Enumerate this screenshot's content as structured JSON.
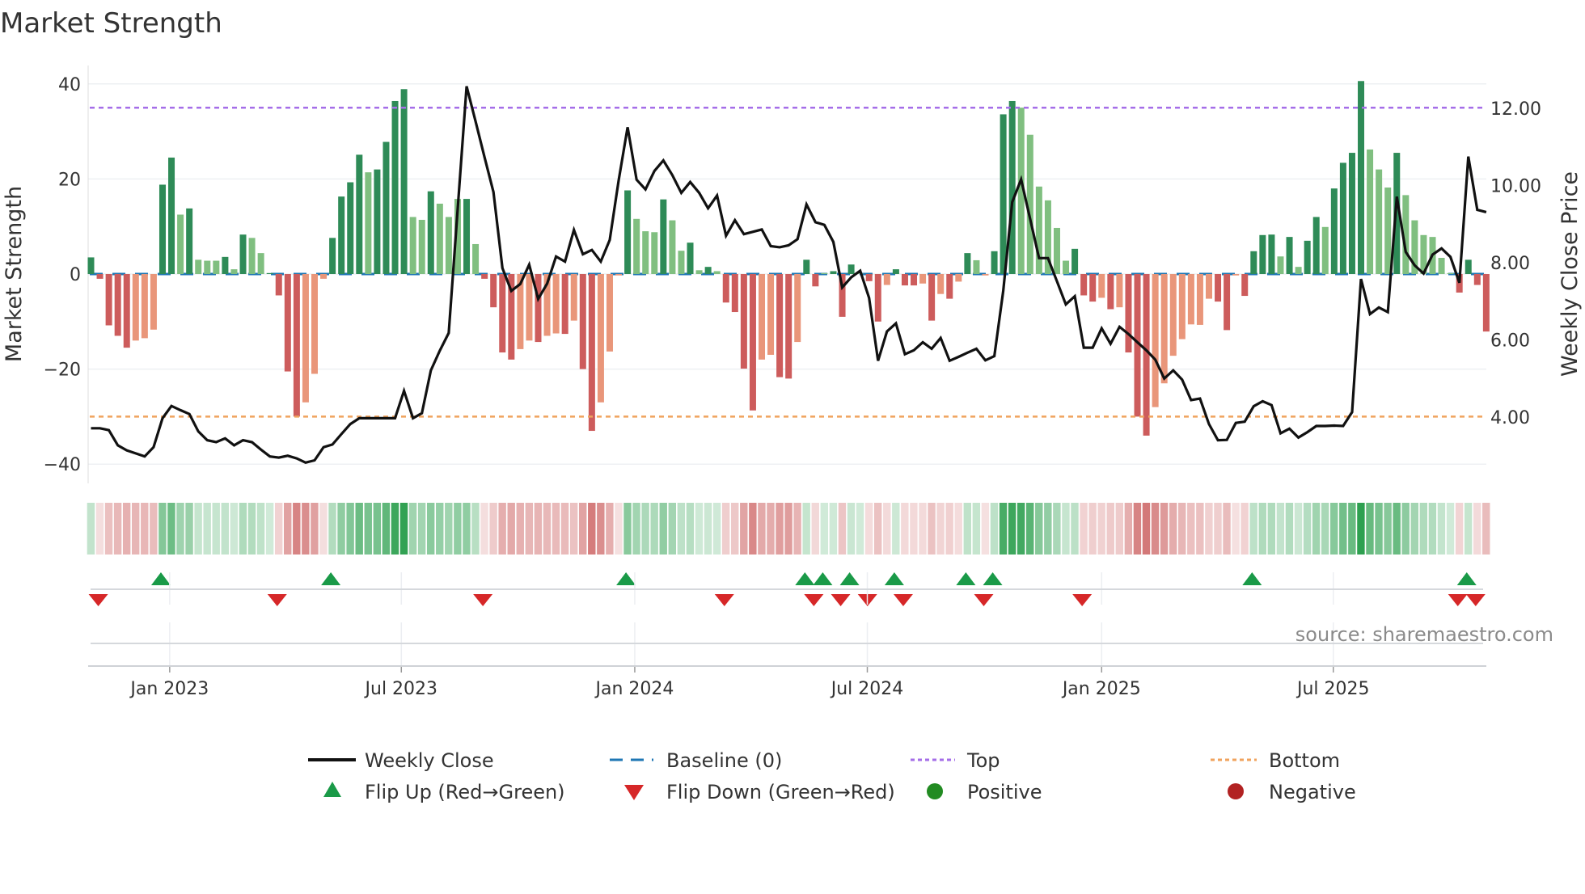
{
  "chart_data": {
    "type": "bar",
    "title": "Market Strength",
    "ylabel": "Market Strength",
    "y2label": "Weekly Close Price",
    "ylim": [
      -44,
      44
    ],
    "y2lim": [
      2.5,
      12.9
    ],
    "left_ticks": [
      {
        "v": 40,
        "label": "40"
      },
      {
        "v": 20,
        "label": "20"
      },
      {
        "v": 0,
        "label": "0"
      },
      {
        "v": -20,
        "label": "−20"
      },
      {
        "v": -40,
        "label": "−40"
      }
    ],
    "right_ticks": [
      {
        "v": 12,
        "label": "12.00"
      },
      {
        "v": 10,
        "label": "10.00"
      },
      {
        "v": 8,
        "label": "8.00"
      },
      {
        "v": 6,
        "label": "6.00"
      },
      {
        "v": 4,
        "label": "4.00"
      }
    ],
    "x_ticks": [
      "Jan 2023",
      "Jul 2023",
      "Jan 2024",
      "Jul 2024",
      "Jan 2025",
      "Jul 2025"
    ],
    "top_level": 35,
    "bottom_level": -30,
    "baseline": 0,
    "strength": [
      3.5,
      -1,
      -10.8,
      -13,
      -15.5,
      -14,
      -13.5,
      -11.7,
      18.8,
      24.5,
      12.5,
      13.8,
      3,
      2.8,
      2.8,
      3.6,
      1,
      8.3,
      7.6,
      4.4,
      0.2,
      -4.5,
      -20.5,
      -30,
      -27,
      -21,
      -1,
      7.6,
      16.3,
      19.3,
      25.1,
      21.4,
      22,
      27.8,
      36.4,
      38.9,
      12,
      11.4,
      17.4,
      14.8,
      12,
      15.8,
      15.8,
      6.3,
      -1,
      -7,
      -16.5,
      -18,
      -15.8,
      -14,
      -14.3,
      -13,
      -12.5,
      -12.6,
      -9.8,
      -20,
      -33,
      -27,
      -16.3,
      -0.3,
      17.6,
      11.6,
      9,
      8.8,
      15.7,
      11.3,
      4.9,
      6.6,
      0.8,
      1.5,
      0.6,
      -6,
      -8,
      -19.9,
      -28.7,
      -18,
      -17,
      -21.7,
      -22,
      -14.3,
      3,
      -2.6,
      0.2,
      0.6,
      -9,
      2,
      0.1,
      -1.5,
      -10,
      -2.3,
      1,
      -2.4,
      -2.4,
      -2,
      -9.8,
      -4.2,
      -5.2,
      -1.6,
      4.4,
      2.9,
      -0.3,
      4.8,
      33.6,
      36.4,
      35,
      29.3,
      18.4,
      15.5,
      9.7,
      2.8,
      5.3,
      -4.5,
      -5.8,
      -5,
      -7.4,
      -7,
      -16.5,
      -30,
      -34,
      -28,
      -23,
      -17.2,
      -13.7,
      -10.6,
      -10.7,
      -5.2,
      -5.8,
      -11.8,
      -0.3,
      -4.6,
      4.8,
      8.2,
      8.3,
      3.7,
      7.8,
      1.5,
      7,
      12,
      9.9,
      18,
      23.4,
      25.5,
      40.6,
      26.2,
      22,
      18.2,
      25.5,
      16.6,
      11.3,
      8.2,
      7.8,
      3.4,
      0.2,
      -3.9,
      3,
      -2.3,
      -12.1
    ],
    "strength_shade": "GRRRRrrrGGgGgggGgGggGRRRrrrGGGGgGGGGggGgggGgRRRRrrRrrRrRRrrrGgggGggGgGgRRRRrrRRrGRgGRGgRRrGRRrRrRrGgrGGGggggggGRRrRrRRRrrrrrrrRRrRGGGgGgGGgGGGGgggGggggggRGRR",
    "weekly_close": [
      3.71,
      3.71,
      3.66,
      3.27,
      3.14,
      3.06,
      2.98,
      3.22,
      3.97,
      4.29,
      4.18,
      4.08,
      3.63,
      3.4,
      3.35,
      3.45,
      3.27,
      3.4,
      3.35,
      3.16,
      2.98,
      2.95,
      3.0,
      2.93,
      2.82,
      2.88,
      3.22,
      3.29,
      3.56,
      3.82,
      3.97,
      3.97,
      3.97,
      3.97,
      3.97,
      4.68,
      3.97,
      4.1,
      5.21,
      5.72,
      6.18,
      9.4,
      12.57,
      11.66,
      10.74,
      9.83,
      7.86,
      7.27,
      7.45,
      7.95,
      7.06,
      7.46,
      8.16,
      8.03,
      8.85,
      8.22,
      8.33,
      8.03,
      8.59,
      10.13,
      11.51,
      10.15,
      9.9,
      10.38,
      10.65,
      10.27,
      9.81,
      10.09,
      9.81,
      9.41,
      9.74,
      8.7,
      9.1,
      8.74,
      8.8,
      8.86,
      8.43,
      8.4,
      8.45,
      8.61,
      9.51,
      9.05,
      8.98,
      8.54,
      7.36,
      7.62,
      7.79,
      7.09,
      5.46,
      6.22,
      6.43,
      5.63,
      5.73,
      5.94,
      5.77,
      6.05,
      5.46,
      5.56,
      5.67,
      5.77,
      5.47,
      5.58,
      7.27,
      9.57,
      10.16,
      9.14,
      8.12,
      8.12,
      7.52,
      6.92,
      7.13,
      5.8,
      5.8,
      6.3,
      5.9,
      6.34,
      6.15,
      5.94,
      5.73,
      5.49,
      5.0,
      5.21,
      4.97,
      4.44,
      4.48,
      3.82,
      3.4,
      3.41,
      3.85,
      3.88,
      4.28,
      4.41,
      4.31,
      3.58,
      3.7,
      3.47,
      3.61,
      3.77,
      3.77,
      3.78,
      3.77,
      4.13,
      7.58,
      6.67,
      6.84,
      6.72,
      9.71,
      8.28,
      7.93,
      7.72,
      8.21,
      8.37,
      8.15,
      7.48,
      10.75,
      9.37,
      9.31
    ],
    "flip_up_weeks": [
      8,
      27,
      60,
      80,
      82,
      85,
      90,
      98,
      101,
      130,
      154
    ],
    "flip_down_weeks": [
      1,
      21,
      44,
      71,
      81,
      84,
      87,
      91,
      100,
      111,
      153,
      155
    ],
    "legend": {
      "weekly_close": "Weekly Close",
      "baseline": "Baseline (0)",
      "top": "Top",
      "bottom": "Bottom",
      "flip_up": "Flip Up (Red→Green)",
      "flip_down": "Flip Down (Green→Red)",
      "positive": "Positive",
      "negative": "Negative"
    },
    "legend_placement": "bottom",
    "colors": {
      "strong_pos": "#2e8b57",
      "weak_pos": "#80bf80",
      "strong_neg": "#cd5c5c",
      "weak_neg": "#e9967a",
      "baseline": "#1f77b4",
      "top": "#a56ee8",
      "bottom": "#f0a35e",
      "flip_up": "#1a9a48",
      "flip_down": "#d62728",
      "positive": "#228b22",
      "negative": "#b22222",
      "close": "#111111"
    }
  },
  "source": "source: sharemaestro.com"
}
